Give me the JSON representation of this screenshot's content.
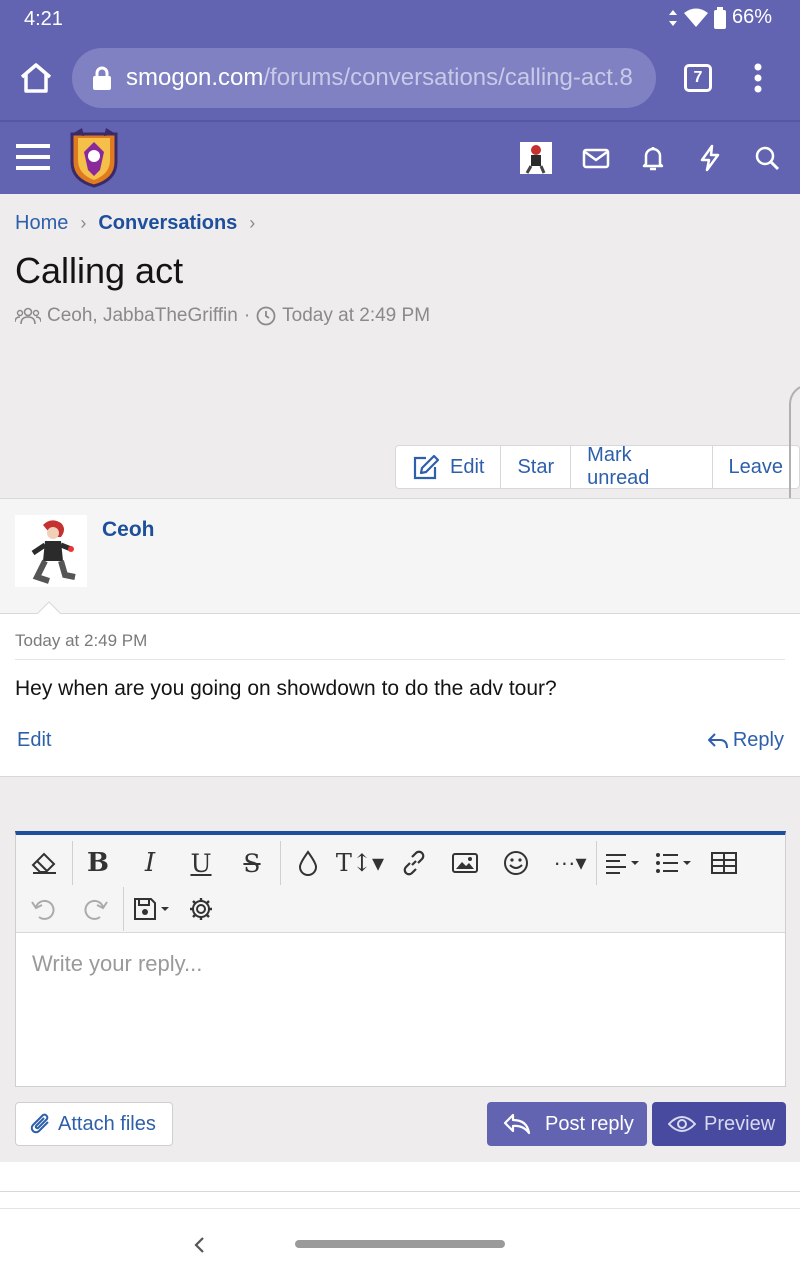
{
  "status_bar": {
    "time": "4:21",
    "battery": "66%"
  },
  "browser": {
    "url_domain": "smogon.com",
    "url_path": "/forums/conversations/calling-act.8",
    "tab_count": "7"
  },
  "breadcrumb": {
    "home": "Home",
    "conversations": "Conversations"
  },
  "page": {
    "title": "Calling act",
    "participants": "Ceoh, JabbaTheGriffin",
    "meta_separator": "·",
    "date": "Today at 2:49 PM"
  },
  "actions": {
    "edit": "Edit",
    "star": "Star",
    "mark_unread": "Mark unread",
    "leave": "Leave"
  },
  "message": {
    "author": "Ceoh",
    "date": "Today at 2:49 PM",
    "text": "Hey when are you going on showdown to do the adv tour?",
    "edit": "Edit",
    "reply": "Reply"
  },
  "editor": {
    "placeholder": "Write your reply...",
    "attach": "Attach files",
    "post_reply": "Post reply",
    "preview": "Preview"
  },
  "colors": {
    "brand": "#6264b2",
    "link": "#2d5fab",
    "accent_dark": "#1e4f9c"
  }
}
